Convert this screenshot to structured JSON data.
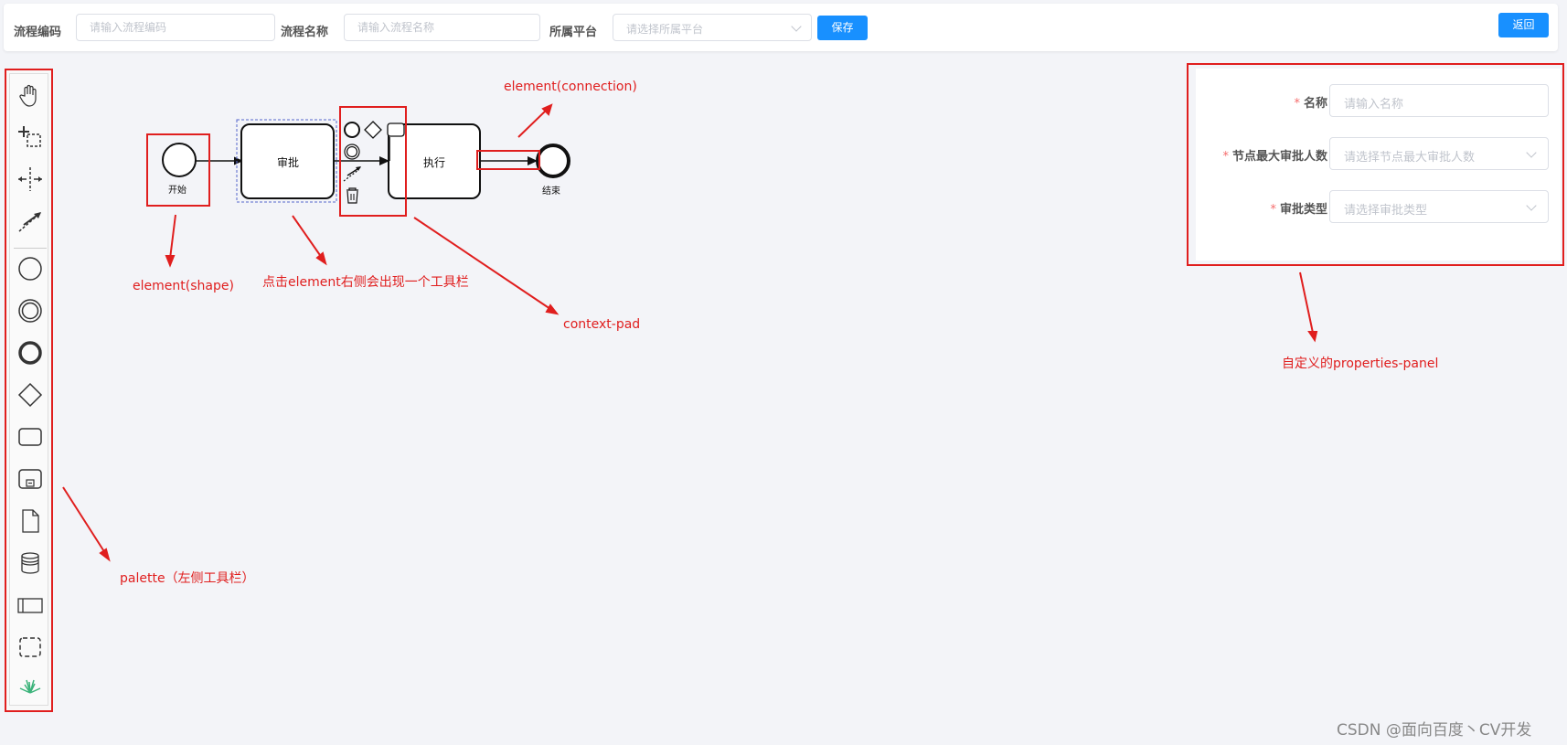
{
  "toolbar": {
    "process_code_label": "流程编码",
    "process_code_placeholder": "请输入流程编码",
    "process_name_label": "流程名称",
    "process_name_placeholder": "请输入流程名称",
    "platform_label": "所属平台",
    "platform_placeholder": "请选择所属平台",
    "save_label": "保存",
    "back_label": "返回"
  },
  "palette": {
    "tools": [
      "hand-tool-icon",
      "lasso-tool-icon",
      "space-tool-icon",
      "global-connect-icon",
      "start-event-icon",
      "intermediate-event-icon",
      "end-event-icon",
      "gateway-icon",
      "task-icon",
      "subprocess-icon",
      "data-object-icon",
      "data-store-icon",
      "pool-icon",
      "group-icon",
      "plant-icon"
    ]
  },
  "diagram": {
    "start_label": "开始",
    "approve_label": "审批",
    "execute_label": "执行",
    "end_label": "结束"
  },
  "annotations": {
    "connection": "element(connection)",
    "shape": "element(shape)",
    "toolbar_hint": "点击element右侧会出现一个工具栏",
    "context_pad": "context-pad",
    "palette": "palette（左侧工具栏）",
    "properties_panel": "自定义的properties-panel"
  },
  "properties": {
    "name_label": "名称",
    "name_placeholder": "请输入名称",
    "max_approvers_label": "节点最大审批人数",
    "max_approvers_placeholder": "请选择节点最大审批人数",
    "approval_type_label": "审批类型",
    "approval_type_placeholder": "请选择审批类型"
  },
  "watermark": "CSDN @面向百度丶CV开发",
  "colors": {
    "primary": "#1890ff",
    "annotation": "#e01e1e",
    "required": "#f56c6c"
  }
}
